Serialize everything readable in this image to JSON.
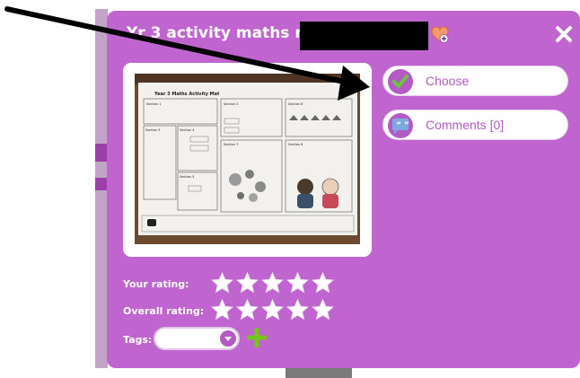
{
  "modal": {
    "title": "Yr 3 activity maths mat -",
    "close_icon": "close-icon",
    "heart_icon": "heart-add-icon"
  },
  "preview": {
    "heading": "Year 3 Maths Activity Mat",
    "sections": [
      "Section 1",
      "Section 2",
      "Section 3",
      "Section 4",
      "Section 5",
      "Section 6",
      "Section 7",
      "Section 8"
    ]
  },
  "actions": {
    "choose_label": "Choose",
    "comments_label": "Comments [0]"
  },
  "ratings": {
    "your_label": "Your rating:",
    "overall_label": "Overall rating:",
    "your_value": 0,
    "overall_value": 0,
    "max": 5
  },
  "tags": {
    "label": "Tags:",
    "value": ""
  },
  "colors": {
    "modal_bg": "#c064d0",
    "accent": "#b35ac4",
    "check_green": "#6fc23c",
    "add_green": "#77c41a"
  }
}
